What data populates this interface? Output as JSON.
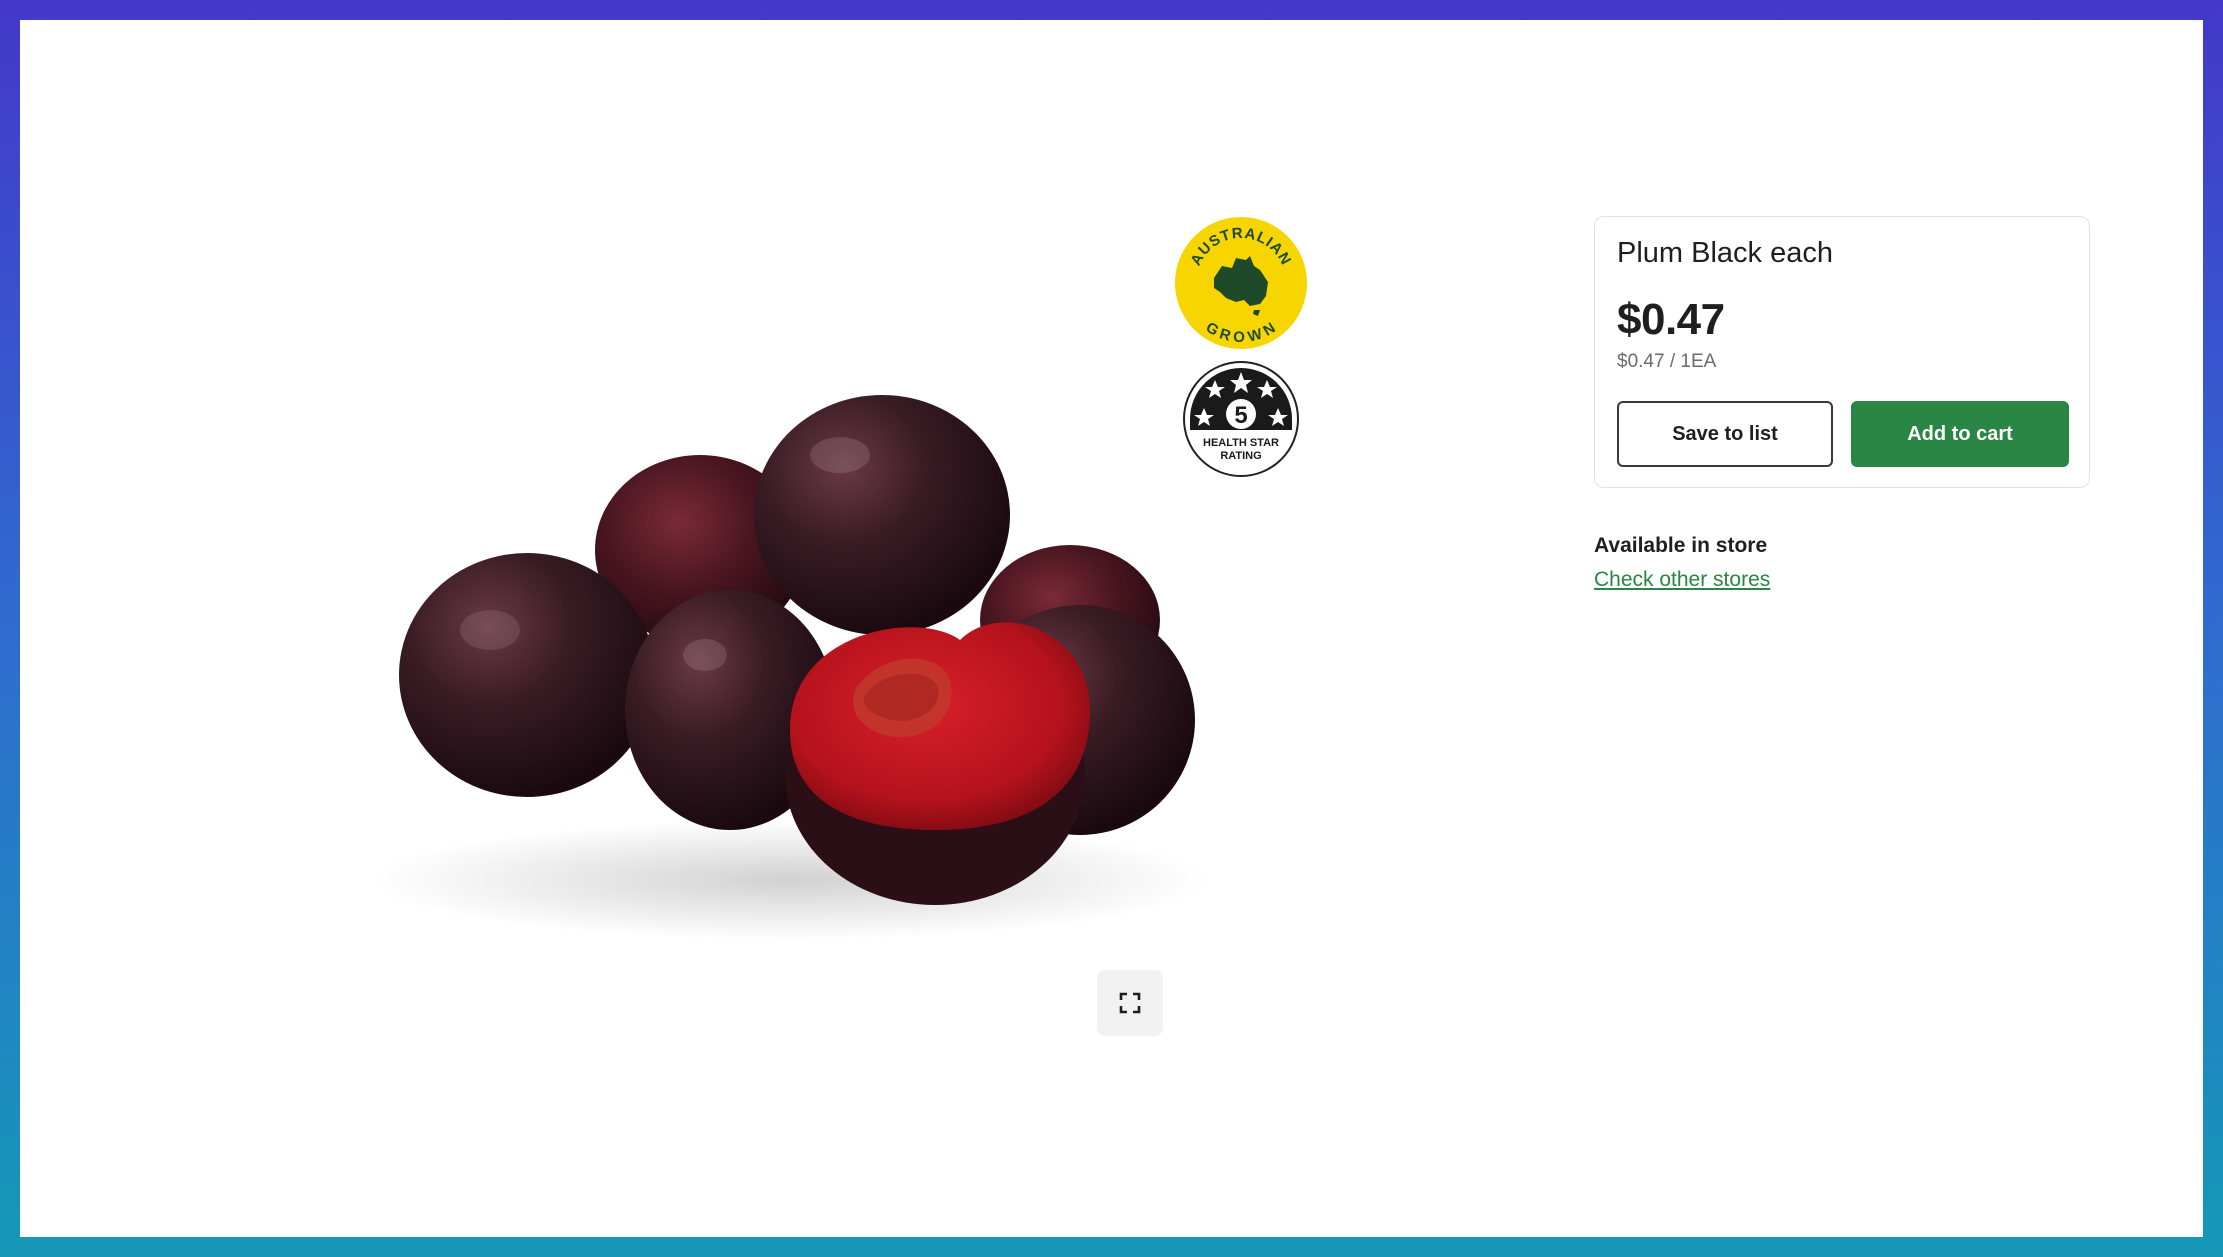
{
  "product": {
    "title": "Plum Black each",
    "price": "$0.47",
    "unit_price": "$0.47 / 1EA",
    "image_icon": "plum-image"
  },
  "badges": {
    "australian_grown": {
      "top_text": "AUSTRALIAN",
      "bottom_text": "GROWN",
      "color": "#f7d500"
    },
    "health_star": {
      "rating": "5",
      "line1": "HEALTH STAR",
      "line2": "RATING"
    }
  },
  "actions": {
    "save_label": "Save to list",
    "cart_label": "Add to cart"
  },
  "availability": {
    "status": "Available in store",
    "link": "Check other stores"
  },
  "colors": {
    "accent_green": "#2a8644",
    "frame_top": "#4338ca",
    "frame_bottom": "#1598b8"
  },
  "icons": {
    "expand": "expand-icon"
  }
}
